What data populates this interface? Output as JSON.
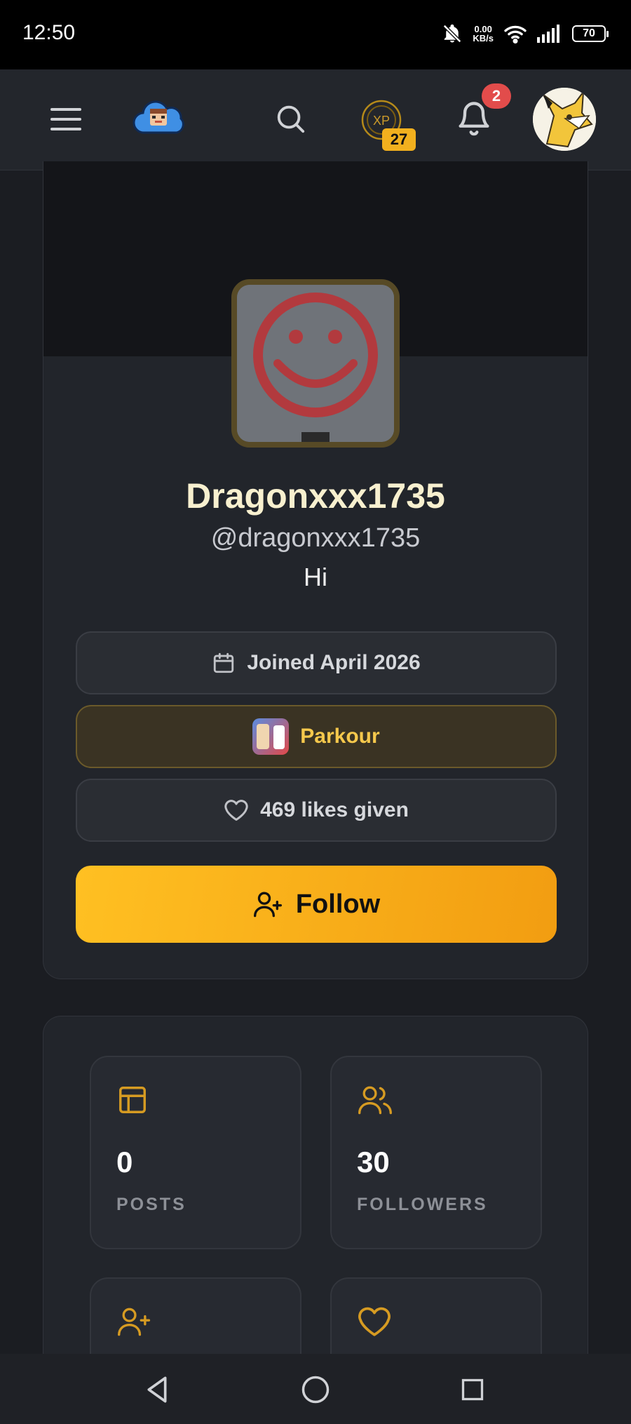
{
  "status_bar": {
    "time": "12:50",
    "net_speed_value": "0.00",
    "net_speed_unit": "KB/s",
    "battery": "70"
  },
  "top_nav": {
    "xp_label": "XP",
    "xp_level": "27",
    "notification_count": "2"
  },
  "profile": {
    "display_name": "Dragonxxx1735",
    "handle": "@dragonxxx1735",
    "bio": "Hi",
    "joined": "Joined April 2026",
    "favorite_game": "Parkour",
    "likes_given": "469 likes given",
    "follow_label": "Follow"
  },
  "stats": [
    {
      "value": "0",
      "label": "POSTS"
    },
    {
      "value": "30",
      "label": "FOLLOWERS"
    },
    {
      "value": "",
      "label": ""
    },
    {
      "value": "",
      "label": ""
    }
  ],
  "colors": {
    "accent": "#f2b01e",
    "background": "#1b1d22",
    "card": "#22252b",
    "notification": "#e24c4b"
  },
  "icons": {
    "menu": "hamburger-menu-icon",
    "logo": "cloud-logo-icon",
    "search": "search-icon",
    "bell": "bell-icon",
    "calendar": "calendar-icon",
    "heart": "heart-icon",
    "user_plus": "user-plus-icon",
    "posts": "layout-icon",
    "followers": "users-icon"
  }
}
